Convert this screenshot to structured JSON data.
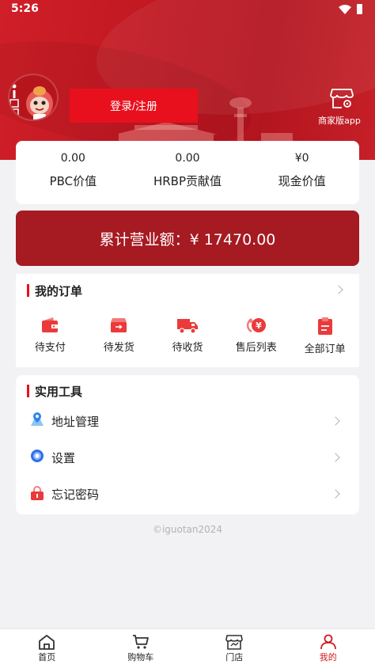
{
  "status_bar": {
    "time": "5:26"
  },
  "header": {
    "login_label": "登录/注册",
    "merchant_app_label": "商家版app"
  },
  "stats": [
    {
      "value": "0.00",
      "label": "PBC价值"
    },
    {
      "value": "0.00",
      "label": "HRBP贡献值"
    },
    {
      "value": "¥0",
      "label": "现金价值"
    }
  ],
  "revenue": {
    "text": "累计营业额：¥ 17470.00"
  },
  "orders": {
    "title": "我的订单",
    "items": [
      {
        "label": "待支付",
        "icon": "wallet-icon"
      },
      {
        "label": "待发货",
        "icon": "box-icon"
      },
      {
        "label": "待收货",
        "icon": "truck-icon"
      },
      {
        "label": "售后列表",
        "icon": "refund-icon"
      },
      {
        "label": "全部订单",
        "icon": "clipboard-icon"
      }
    ]
  },
  "tools": {
    "title": "实用工具",
    "items": [
      {
        "label": "地址管理",
        "icon": "map-pin-icon"
      },
      {
        "label": "设置",
        "icon": "gear-icon"
      },
      {
        "label": "忘记密码",
        "icon": "lock-icon"
      }
    ]
  },
  "copyright": "©iguotan2024",
  "tabbar": [
    {
      "label": "首页",
      "icon": "home-icon"
    },
    {
      "label": "购物车",
      "icon": "cart-icon"
    },
    {
      "label": "门店",
      "icon": "store-icon"
    },
    {
      "label": "我的",
      "icon": "user-icon",
      "active": true
    }
  ],
  "colors": {
    "brand_red": "#e8101c",
    "revenue_bg": "#a61a22",
    "active_tab": "#d0191f"
  }
}
